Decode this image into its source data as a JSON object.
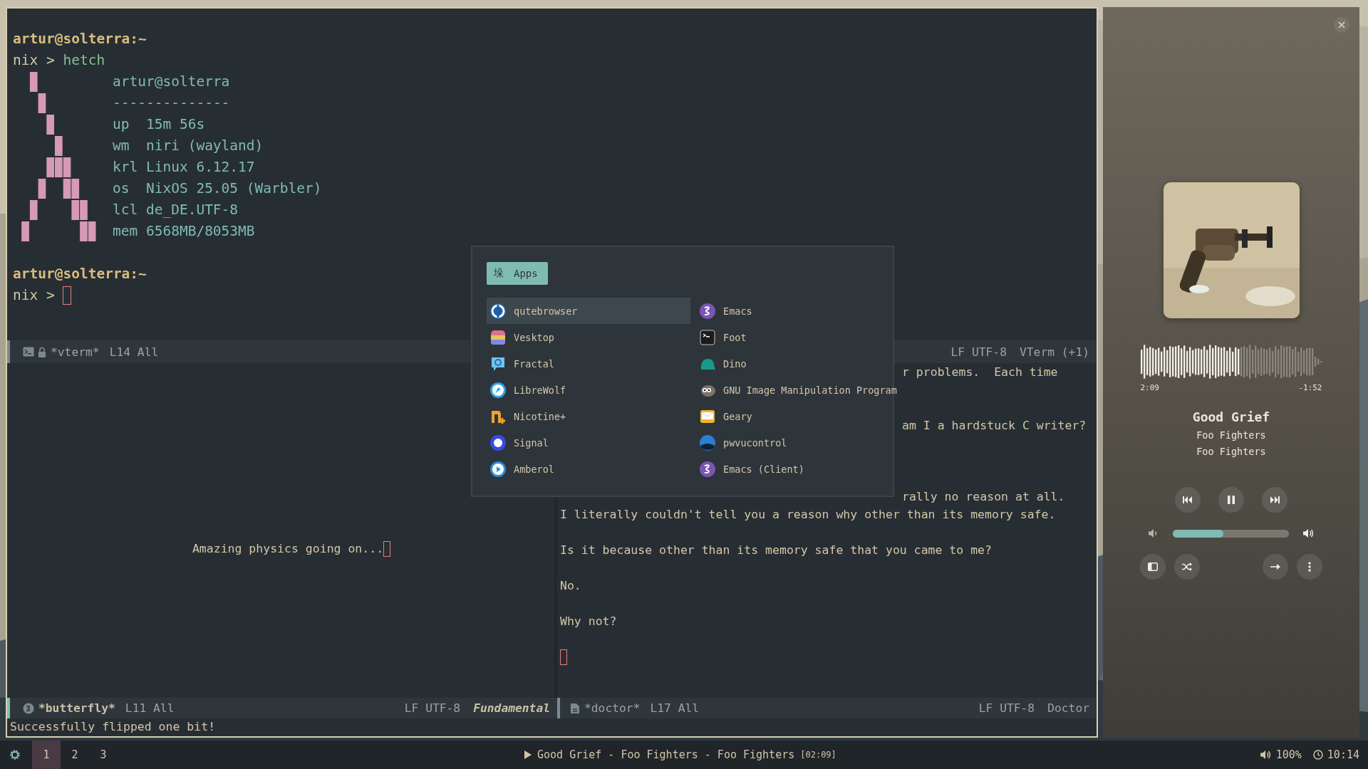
{
  "emacs": {
    "vterm": {
      "blocks": [
        {
          "kind": "host",
          "text": "artur@solterra:~"
        },
        {
          "kind": "command",
          "prompt": "nix >",
          "text": "hetch"
        },
        {
          "kind": "fetch",
          "title": "artur@solterra",
          "rule": "--------------",
          "fields": [
            {
              "key": "up",
              "value": "15m 56s"
            },
            {
              "key": "wm",
              "value": "niri (wayland)"
            },
            {
              "key": "krl",
              "value": "Linux 6.12.17"
            },
            {
              "key": "os",
              "value": "NixOS 25.05 (Warbler)"
            },
            {
              "key": "lcl",
              "value": "de_DE.UTF-8"
            },
            {
              "key": "mem",
              "value": "6568MB/8053MB"
            }
          ]
        },
        {
          "kind": "blank"
        },
        {
          "kind": "host",
          "text": "artur@solterra:~"
        },
        {
          "kind": "input",
          "prompt": "nix >"
        }
      ],
      "modeline": {
        "buffer": "*vterm*",
        "position": "L14 All",
        "encoding": "LF UTF-8",
        "mode": "VTerm (+1)",
        "active": false
      }
    },
    "butterfly": {
      "text": "Amazing physics going on...",
      "modeline": {
        "buffer": "*butterfly*",
        "position": "L11 All",
        "encoding": "LF UTF-8",
        "mode": "Fundamental",
        "active": true
      }
    },
    "doctor": {
      "lines": [
        {
          "kind": "clipped",
          "text": "r problems.  Each time"
        },
        {
          "kind": "blank"
        },
        {
          "kind": "blank"
        },
        {
          "kind": "clipped",
          "text": "am I a hardstuck C writer?"
        },
        {
          "kind": "blank"
        },
        {
          "kind": "blank"
        },
        {
          "kind": "blank"
        },
        {
          "kind": "clipped",
          "text": "rally no reason at all."
        },
        {
          "kind": "text",
          "text": "I literally couldn't tell you a reason why other than its memory safe."
        },
        {
          "kind": "blank"
        },
        {
          "kind": "text",
          "text": "Is it because other than its memory safe that you came to me?"
        },
        {
          "kind": "blank"
        },
        {
          "kind": "text",
          "text": "No."
        },
        {
          "kind": "blank"
        },
        {
          "kind": "text",
          "text": "Why not?"
        },
        {
          "kind": "blank"
        },
        {
          "kind": "cursor"
        }
      ],
      "modeline": {
        "buffer": "*doctor*",
        "position": "L17 All",
        "encoding": "LF UTF-8",
        "mode": "Doctor",
        "active": false
      }
    },
    "echo": "Successfully flipped one bit!"
  },
  "launcher": {
    "tab": {
      "glyph": "垛",
      "label": "Apps"
    },
    "items": [
      {
        "label": "qutebrowser",
        "selected": true
      },
      {
        "label": "Emacs",
        "selected": false
      },
      {
        "label": "Vesktop",
        "selected": false
      },
      {
        "label": "Foot",
        "selected": false
      },
      {
        "label": "Fractal",
        "selected": false
      },
      {
        "label": "Dino",
        "selected": false
      },
      {
        "label": "LibreWolf",
        "selected": false
      },
      {
        "label": "GNU Image Manipulation Program",
        "selected": false
      },
      {
        "label": "Nicotine+",
        "selected": false
      },
      {
        "label": "Geary",
        "selected": false
      },
      {
        "label": "Signal",
        "selected": false
      },
      {
        "label": "pwvucontrol",
        "selected": false
      },
      {
        "label": "Amberol",
        "selected": false
      },
      {
        "label": "Emacs (Client)",
        "selected": false
      }
    ]
  },
  "player": {
    "progress": {
      "level": 0.54,
      "elapsed": "2:09",
      "remaining": "-1:52"
    },
    "title": "Good Grief",
    "artist": "Foo Fighters",
    "album": "Foo Fighters",
    "volume": {
      "level": 0.44
    }
  },
  "bar": {
    "workspaces": [
      {
        "label": "1",
        "selected": true
      },
      {
        "label": "2",
        "selected": false
      },
      {
        "label": "3",
        "selected": false
      }
    ],
    "now_playing": {
      "text": "Good Grief - Foo Fighters - Foo Fighters",
      "time": "[02:09]"
    },
    "volume": "100%",
    "clock": "10:14"
  }
}
